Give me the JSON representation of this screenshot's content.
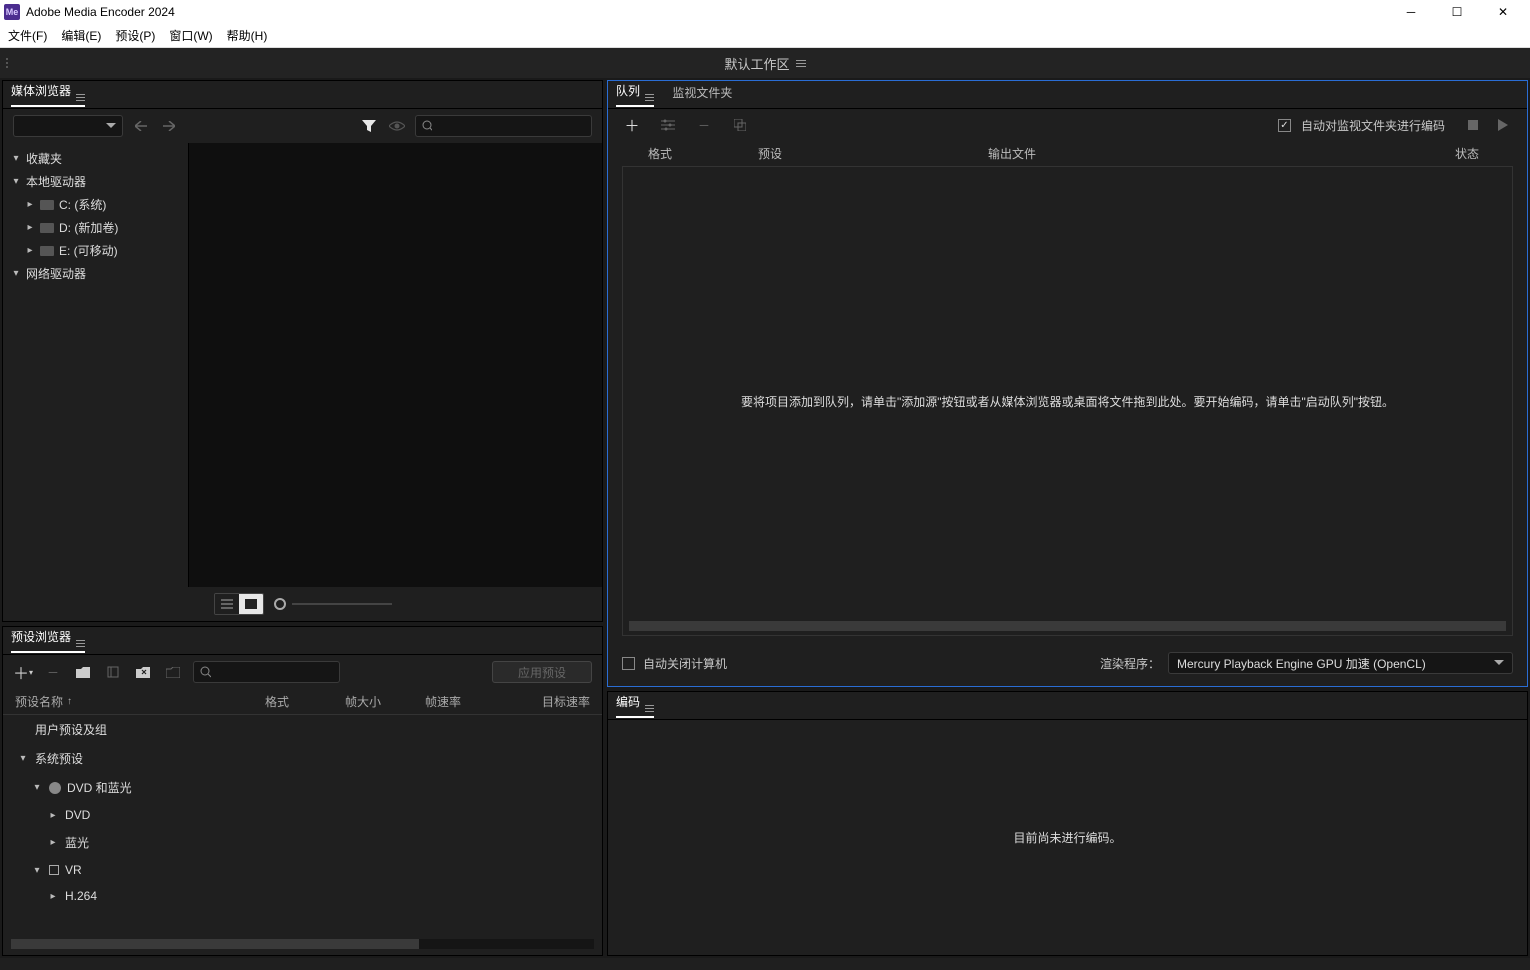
{
  "app": {
    "title": "Adobe Media Encoder 2024",
    "icon": "Me"
  },
  "menu": {
    "file": "文件(F)",
    "edit": "编辑(E)",
    "preset": "预设(P)",
    "window": "窗口(W)",
    "help": "帮助(H)"
  },
  "workspace": {
    "name": "默认工作区"
  },
  "mediaBrowser": {
    "title": "媒体浏览器",
    "tree": {
      "favorites": "收藏夹",
      "localDrives": "本地驱动器",
      "drives": [
        {
          "label": "C: (系统)"
        },
        {
          "label": "D: (新加卷)"
        },
        {
          "label": "E: (可移动)"
        }
      ],
      "networkDrives": "网络驱动器"
    }
  },
  "presetBrowser": {
    "title": "预设浏览器",
    "apply": "应用预设",
    "columns": {
      "name": "预设名称",
      "format": "格式",
      "frameSize": "帧大小",
      "frameRate": "帧速率",
      "targetRate": "目标速率"
    },
    "rows": {
      "userGroup": "用户预设及组",
      "system": "系统预设",
      "dvdBluray": "DVD 和蓝光",
      "dvd": "DVD",
      "bluray": "蓝光",
      "vr": "VR",
      "h264": "H.264"
    }
  },
  "queue": {
    "tab": "队列",
    "watchTab": "监视文件夹",
    "autoEncode": "自动对监视文件夹进行编码",
    "columns": {
      "format": "格式",
      "preset": "预设",
      "output": "输出文件",
      "status": "状态"
    },
    "emptyHint": "要将项目添加到队列，请单击\"添加源\"按钮或者从媒体浏览器或桌面将文件拖到此处。要开始编码，请单击\"启动队列\"按钮。",
    "autoShutdown": "自动关闭计算机",
    "rendererLabel": "渲染程序：",
    "renderer": "Mercury Playback Engine GPU 加速 (OpenCL)"
  },
  "encode": {
    "title": "编码",
    "idle": "目前尚未进行编码。"
  }
}
